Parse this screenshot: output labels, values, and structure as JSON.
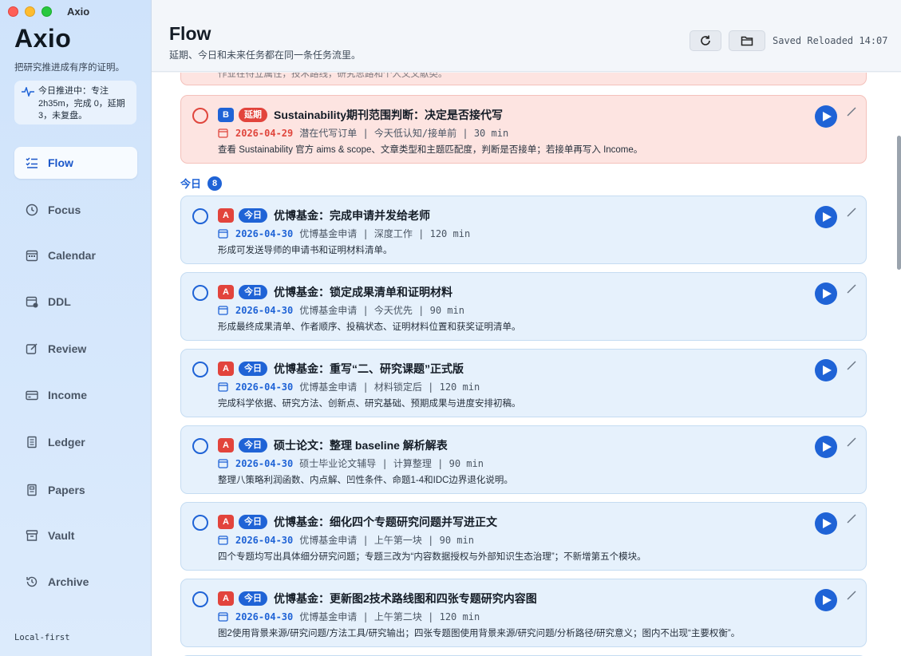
{
  "window": {
    "title": "Axio"
  },
  "sidebar": {
    "brand": "Axio",
    "tagline": "把研究推进成有序的证明。",
    "status": "今日推进中：专注 2h35m，完成 0，延期 3，未复盘。",
    "items": [
      {
        "label": "Flow",
        "icon": "list-check-icon",
        "active": true
      },
      {
        "label": "Focus",
        "icon": "timer-icon"
      },
      {
        "label": "Calendar",
        "icon": "calendar-icon"
      },
      {
        "label": "DDL",
        "icon": "deadline-calendar-icon"
      },
      {
        "label": "Review",
        "icon": "edit-square-icon"
      },
      {
        "label": "Income",
        "icon": "wallet-icon"
      },
      {
        "label": "Ledger",
        "icon": "ledger-icon"
      },
      {
        "label": "Papers",
        "icon": "document-icon"
      },
      {
        "label": "Vault",
        "icon": "archive-box-icon"
      },
      {
        "label": "Archive",
        "icon": "history-icon"
      }
    ],
    "footer": "Local-first"
  },
  "header": {
    "title": "Flow",
    "subtitle": "延期、今日和未来任务都在同一条任务流里。",
    "saved_status": "Saved Reloaded 14:07"
  },
  "colors": {
    "accent": "#1f63d6",
    "danger": "#e2443c",
    "overdue_bg": "#fde4e1",
    "card_bg": "#e6f1fc"
  },
  "flow": {
    "partial_top": "作业在待立属性，技术路线，研究思路和个人文文献类。",
    "overdue_task": {
      "priority": "B",
      "tag": "延期",
      "title": "Sustainability期刊范围判断：决定是否接代写",
      "date": "2026-04-29",
      "meta": "潜在代写订单 | 今天低认知/接单前 | 30 min",
      "desc": "查看 Sustainability 官方 aims & scope、文章类型和主题匹配度，判断是否接单；若接单再写入 Income。"
    },
    "today_label": "今日",
    "today_count": "8",
    "tasks": [
      {
        "priority": "A",
        "tag": "今日",
        "title": "优博基金：完成申请并发给老师",
        "date": "2026-04-30",
        "meta": "优博基金申请 | 深度工作 | 120 min",
        "desc": "形成可发送导师的申请书和证明材料清单。"
      },
      {
        "priority": "A",
        "tag": "今日",
        "title": "优博基金：锁定成果清单和证明材料",
        "date": "2026-04-30",
        "meta": "优博基金申请 | 今天优先 | 90 min",
        "desc": "形成最终成果清单、作者顺序、投稿状态、证明材料位置和获奖证明清单。"
      },
      {
        "priority": "A",
        "tag": "今日",
        "title": "优博基金：重写“二、研究课题”正式版",
        "date": "2026-04-30",
        "meta": "优博基金申请 | 材料锁定后 | 120 min",
        "desc": "完成科学依据、研究方法、创新点、研究基础、预期成果与进度安排初稿。"
      },
      {
        "priority": "A",
        "tag": "今日",
        "title": "硕士论文：整理 baseline 解析解表",
        "date": "2026-04-30",
        "meta": "硕士毕业论文辅导 | 计算整理 | 90 min",
        "desc": "整理八策略利润函数、内点解、凹性条件、命题1-4和IDC边界退化说明。"
      },
      {
        "priority": "A",
        "tag": "今日",
        "title": "优博基金：细化四个专题研究问题并写进正文",
        "date": "2026-04-30",
        "meta": "优博基金申请 | 上午第一块 | 90 min",
        "desc": "四个专题均写出具体细分研究问题；专题三改为“内容数据授权与外部知识生态治理”；不新增第五个模块。"
      },
      {
        "priority": "A",
        "tag": "今日",
        "title": "优博基金：更新图2技术路线图和四张专题研究内容图",
        "date": "2026-04-30",
        "meta": "优博基金申请 | 上午第二块 | 120 min",
        "desc": "图2使用背景来源/研究问题/方法工具/研究输出；四张专题图使用背景来源/研究问题/分析路径/研究意义；图内不出现“主要权衡”。"
      }
    ]
  }
}
